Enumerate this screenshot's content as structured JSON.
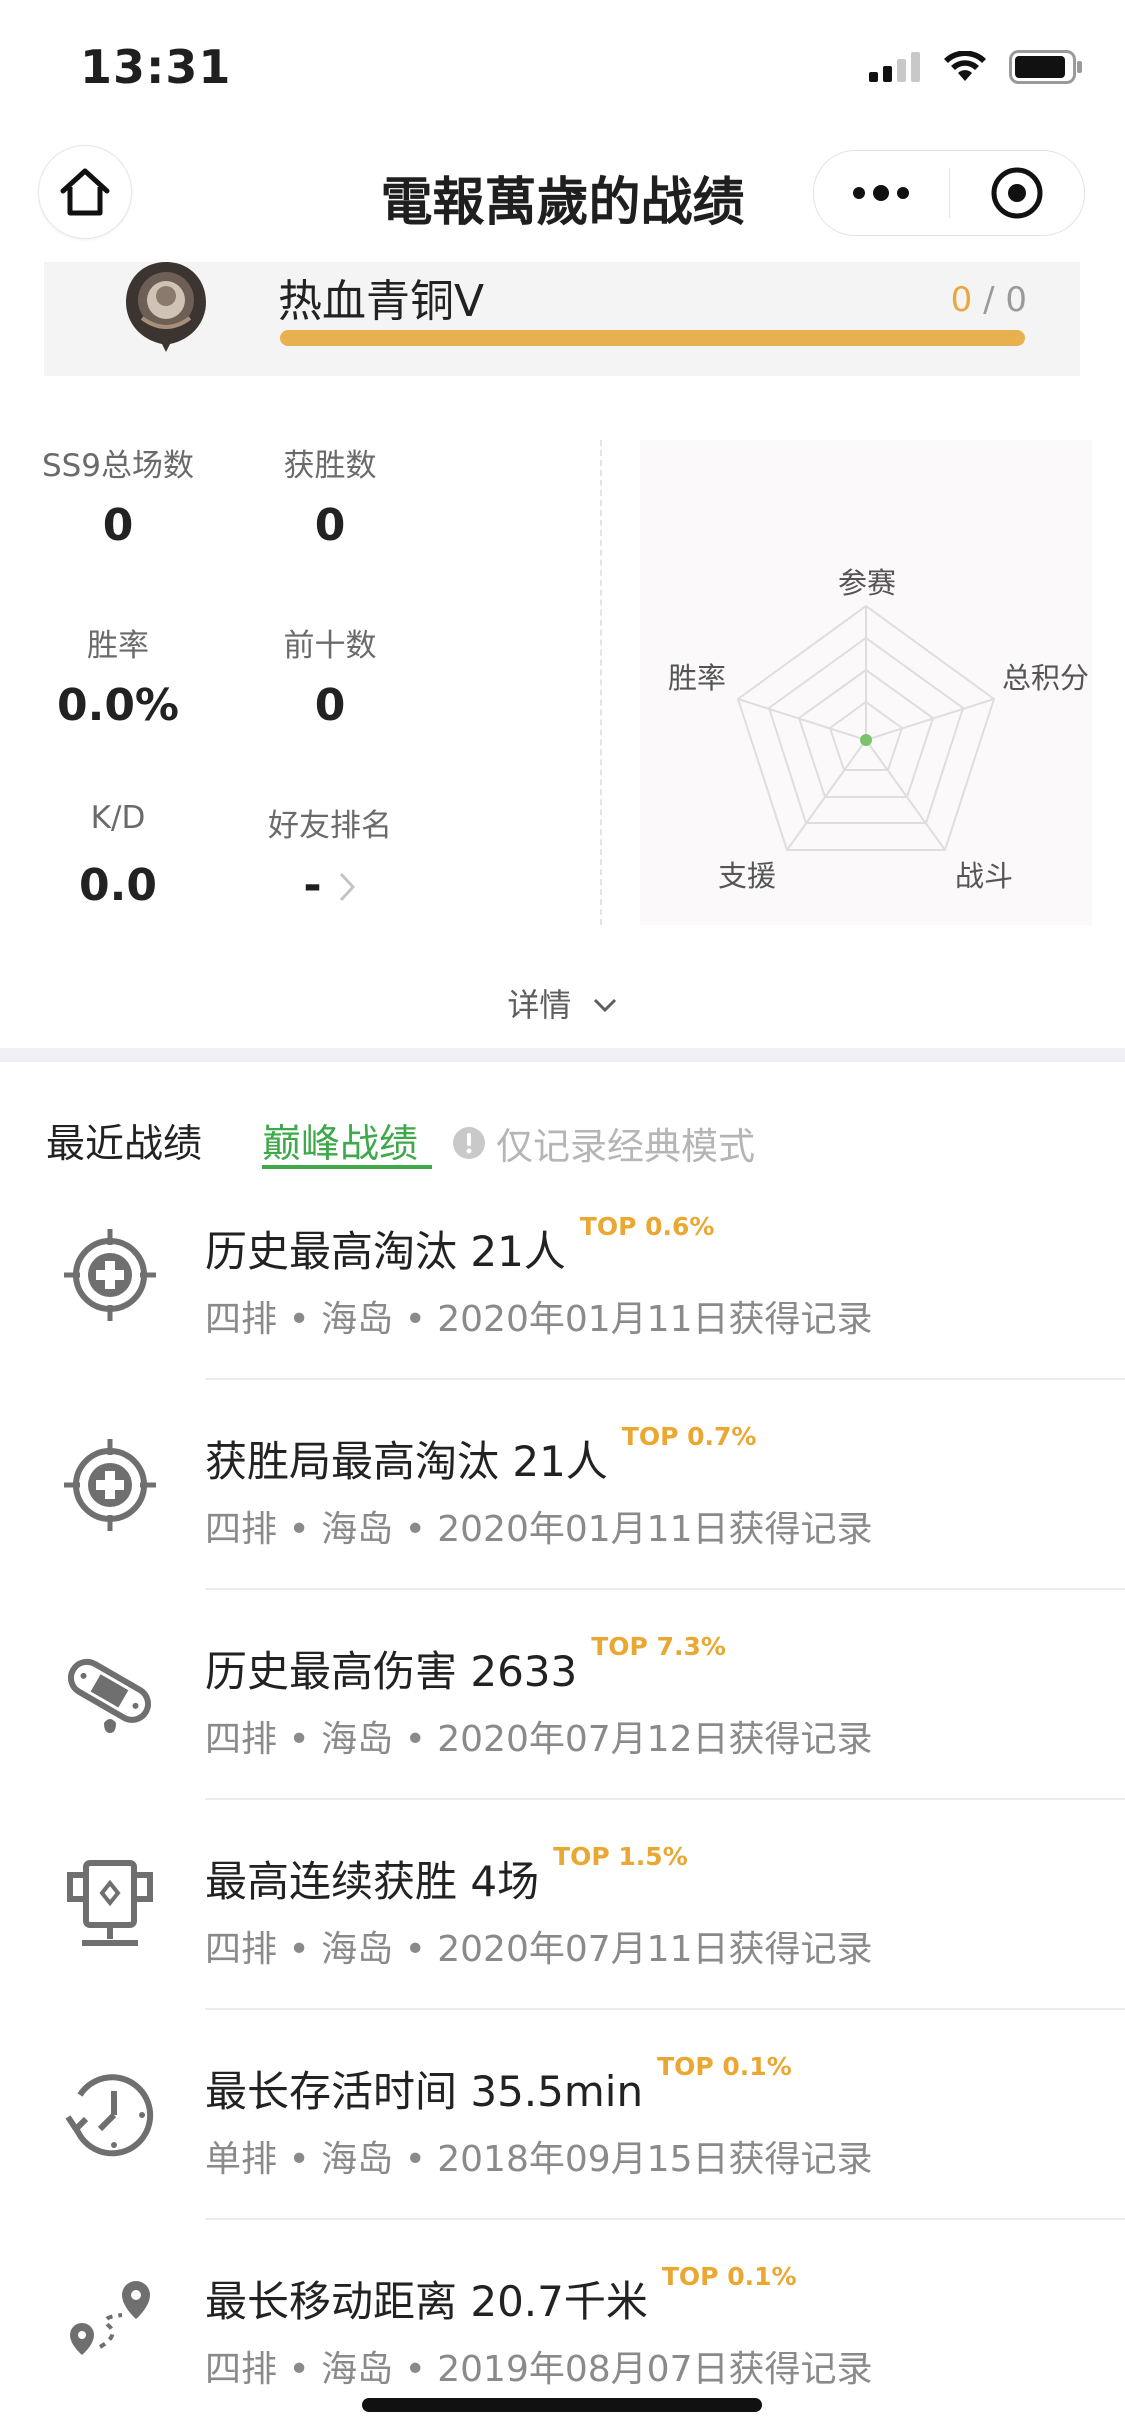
{
  "status_bar": {
    "time": "13:31"
  },
  "nav": {
    "title": "電報萬歲的战绩"
  },
  "rank": {
    "name": "热血青铜V",
    "current": "0",
    "separator": "/",
    "total": "0",
    "progress": 1.0
  },
  "stats": [
    {
      "label": "SS9总场数",
      "value": "0"
    },
    {
      "label": "获胜数",
      "value": "0"
    },
    {
      "label": "胜率",
      "value": "0.0%"
    },
    {
      "label": "前十数",
      "value": "0"
    },
    {
      "label": "K/D",
      "value": "0.0"
    },
    {
      "label": "好友排名",
      "value": "-"
    }
  ],
  "radar": {
    "labels": {
      "top": "参赛",
      "right": "总积分",
      "bottom_right": "战斗",
      "bottom_left": "支援",
      "left": "胜率"
    }
  },
  "details_label": "详情",
  "tabs": {
    "recent": "最近战绩",
    "peak": "巅峰战绩",
    "note": "仅记录经典模式"
  },
  "records": [
    {
      "icon": "crosshair-icon",
      "title": "历史最高淘汰 21人",
      "top": "TOP 0.6%",
      "sub": "四排 • 海岛 • 2020年01月11日获得记录"
    },
    {
      "icon": "crosshair-icon",
      "title": "获胜局最高淘汰 21人",
      "top": "TOP 0.7%",
      "sub": "四排 • 海岛 • 2020年01月11日获得记录"
    },
    {
      "icon": "bandage-icon",
      "title": "历史最高伤害 2633",
      "top": "TOP 7.3%",
      "sub": "四排 • 海岛 • 2020年07月12日获得记录"
    },
    {
      "icon": "trophy-icon",
      "title": "最高连续获胜 4场",
      "top": "TOP 1.5%",
      "sub": "四排 • 海岛 • 2020年07月11日获得记录"
    },
    {
      "icon": "clock-icon",
      "title": "最长存活时间 35.5min",
      "top": "TOP 0.1%",
      "sub": "单排 • 海岛 • 2018年09月15日获得记录"
    },
    {
      "icon": "route-icon",
      "title": "最长移动距离 20.7千米",
      "top": "TOP 0.1%",
      "sub": "四排 • 海岛 • 2019年08月07日获得记录"
    }
  ],
  "colors": {
    "accent_green": "#3ea94a",
    "top_orange": "#eaa731",
    "rank_bar": "#e8b14f"
  }
}
